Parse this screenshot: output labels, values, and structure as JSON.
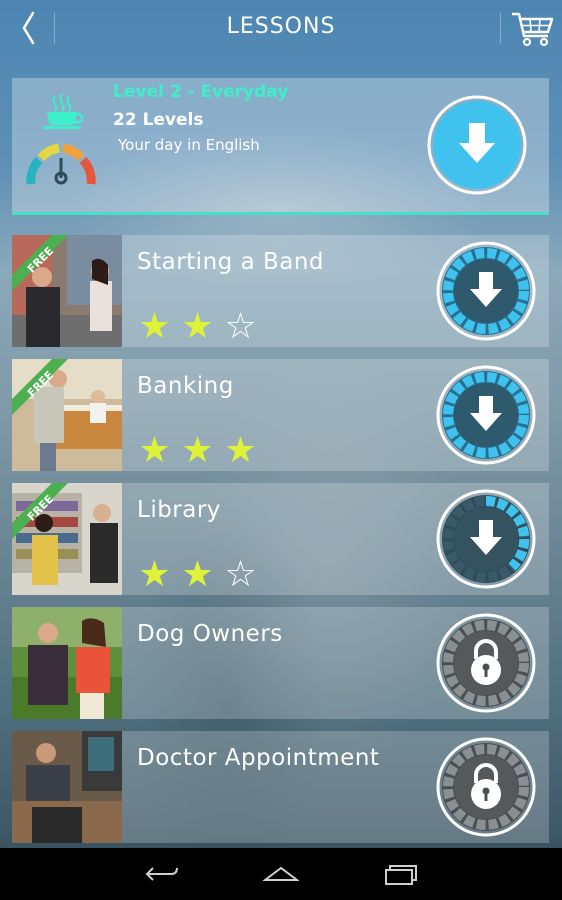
{
  "header": {
    "title": "LESSONS",
    "back_icon": "chevron-left-icon",
    "cart_icon": "shopping-cart-icon"
  },
  "level": {
    "name": "Level 2 - Everyday",
    "count_label": "22 Levels",
    "description": "Your day in English",
    "icon": "coffee-cup-icon",
    "difficulty_icon": "difficulty-gauge-icon",
    "accent_color": "#3ef0c9"
  },
  "lessons": [
    {
      "title": "Starting a Band",
      "badge": "FREE",
      "stars": 2,
      "max_stars": 3,
      "action": "download",
      "progress": 0.0
    },
    {
      "title": "Banking",
      "badge": "FREE",
      "stars": 3,
      "max_stars": 3,
      "action": "download",
      "progress": 0.0
    },
    {
      "title": "Library",
      "badge": "FREE",
      "stars": 2,
      "max_stars": 3,
      "action": "download-in-progress",
      "progress": 0.45
    },
    {
      "title": "Dog Owners",
      "badge": "",
      "stars": 0,
      "max_stars": 0,
      "action": "locked"
    },
    {
      "title": "Doctor Appointment",
      "badge": "",
      "stars": 0,
      "max_stars": 0,
      "action": "locked"
    }
  ],
  "colors": {
    "download_blue": "#3fc3ee",
    "star_yellow": "#dff23a",
    "free_green": "#4caf50"
  },
  "navbar": {
    "back_icon": "back-arrow-icon",
    "home_icon": "home-icon",
    "recents_icon": "recent-apps-icon"
  }
}
